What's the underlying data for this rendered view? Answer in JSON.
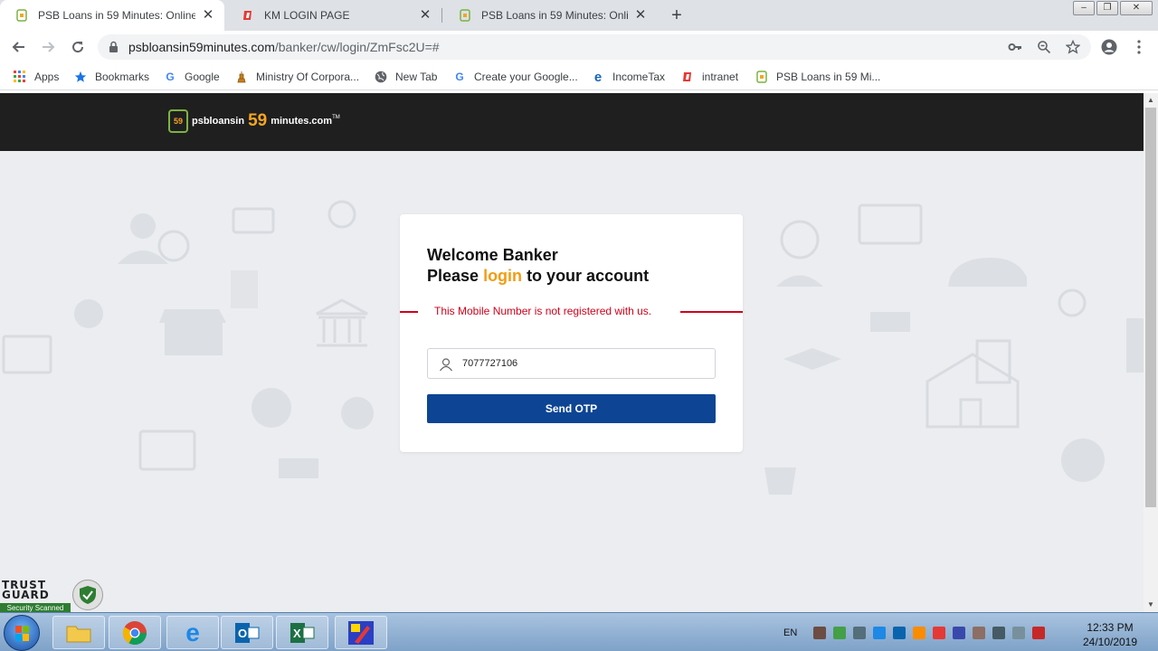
{
  "browser": {
    "tabs": [
      {
        "title": "PSB Loans in 59 Minutes: Online",
        "active": true
      },
      {
        "title": "KM LOGIN PAGE",
        "active": false
      },
      {
        "title": "PSB Loans in 59 Minutes: Online",
        "active": false
      }
    ],
    "url_host": "psbloansin59minutes.com",
    "url_path": "/banker/cw/login/ZmFsc2U=#",
    "bookmarks": [
      "Apps",
      "Bookmarks",
      "Google",
      "Ministry Of Corpora...",
      "New Tab",
      "Create your Google...",
      "IncomeTax",
      "intranet",
      "PSB Loans in 59 Mi..."
    ]
  },
  "site": {
    "logo_text_1": "psbloansin",
    "logo_text_2": "59",
    "logo_text_3": "minutes.com",
    "logo_tm": "TM",
    "logo_badge": "59"
  },
  "login": {
    "heading": "Welcome Banker",
    "subheading_pre": "Please ",
    "subheading_accent": "login",
    "subheading_post": " to your account",
    "error": "This Mobile Number is not registered with us.",
    "mobile_value": "7077727106",
    "send_otp_label": "Send OTP"
  },
  "trustguard": {
    "line1": "TRUST",
    "line2": "GUARD",
    "badge": "Security Scanned"
  },
  "taskbar": {
    "lang": "EN",
    "time": "12:33 PM",
    "date": "24/10/2019"
  },
  "colors": {
    "accent": "#f39c12",
    "button": "#0d4594",
    "error": "#d0021b",
    "header_bg": "#1f1f1f"
  }
}
